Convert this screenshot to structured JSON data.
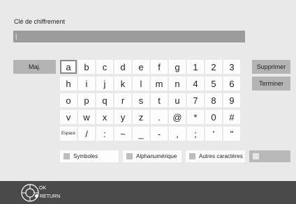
{
  "title": "Clé de chiffrement",
  "input": {
    "value": "|"
  },
  "side_left": {
    "maj": "Maj."
  },
  "side_right": {
    "delete": "Supprimer",
    "finish": "Terminer"
  },
  "keys": [
    "a",
    "b",
    "c",
    "d",
    "e",
    "f",
    "g",
    "1",
    "2",
    "3",
    "h",
    "i",
    "j",
    "k",
    "l",
    "m",
    "n",
    "4",
    "5",
    "6",
    "o",
    "p",
    "q",
    "r",
    "s",
    "t",
    "u",
    "7",
    "8",
    "9",
    "v",
    "w",
    "x",
    "y",
    "z",
    ".",
    "@",
    "*",
    "0",
    "#",
    "Espace",
    "/",
    ":",
    "~",
    "_",
    "-",
    ",",
    ";",
    "'",
    "\""
  ],
  "modes": [
    {
      "label": "Symboles"
    },
    {
      "label": "Alphanumérique"
    },
    {
      "label": "Autres caractères"
    },
    {
      "label": ""
    }
  ],
  "footer": {
    "ok": "OK",
    "return": "RETURN"
  },
  "colors": {
    "background": "#e9e9e9",
    "key": "#fdfdfd",
    "footer": "#4a4a4a"
  }
}
